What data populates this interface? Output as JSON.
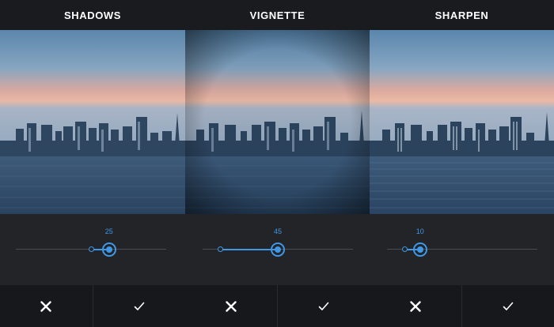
{
  "screens": [
    {
      "title": "SHADOWS",
      "slider": {
        "value_label": "25",
        "origin": 0.5,
        "value": 0.62
      },
      "cancel_icon": "close-icon",
      "confirm_icon": "checkmark-icon"
    },
    {
      "title": "VIGNETTE",
      "slider": {
        "value_label": "45",
        "origin": 0.12,
        "value": 0.5
      },
      "cancel_icon": "close-icon",
      "confirm_icon": "checkmark-icon"
    },
    {
      "title": "SHARPEN",
      "slider": {
        "value_label": "10",
        "origin": 0.12,
        "value": 0.22
      },
      "cancel_icon": "close-icon",
      "confirm_icon": "checkmark-icon"
    }
  ],
  "colors": {
    "accent": "#3f97e6",
    "background": "#232428",
    "top_bar": "#1a1b1f",
    "action_bar": "#17181b",
    "text": "#ffffff"
  }
}
